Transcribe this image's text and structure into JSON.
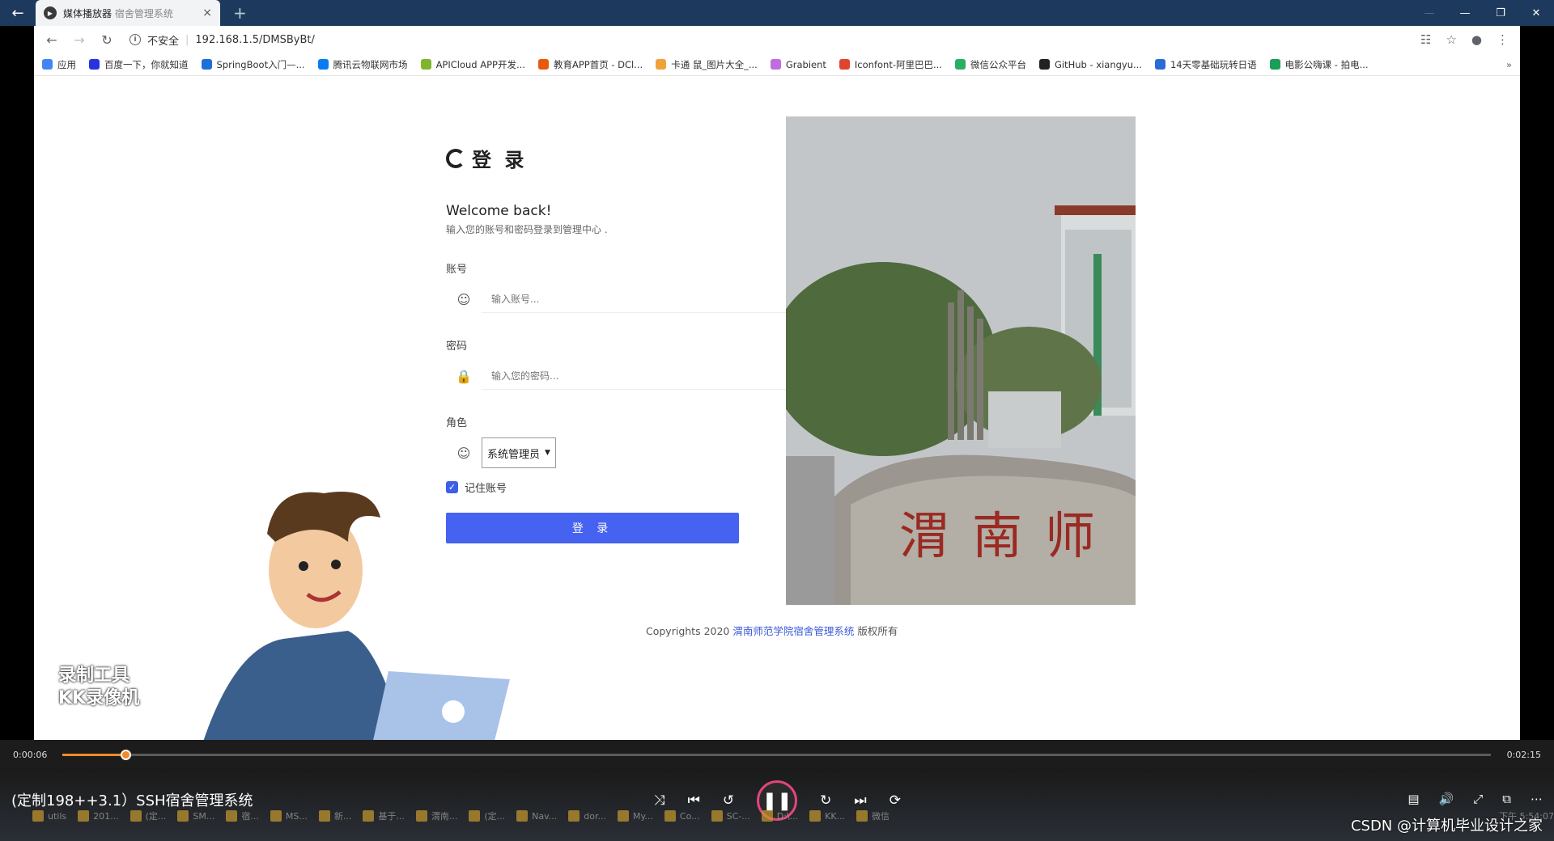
{
  "player_tab": {
    "app": "媒体播放器",
    "page_title": "宿舍管理系统"
  },
  "browser": {
    "security_label": "不安全",
    "url": "192.168.1.5/DMSByBt/",
    "bookmarks": [
      {
        "label": "应用",
        "icon_color": "#4285f4"
      },
      {
        "label": "百度一下，你就知道",
        "icon_color": "#2932e1"
      },
      {
        "label": "SpringBoot入门—...",
        "icon_color": "#1e6fd9"
      },
      {
        "label": "腾讯云物联网市场",
        "icon_color": "#0a7cf2"
      },
      {
        "label": "APICloud APP开发...",
        "icon_color": "#7fb52e"
      },
      {
        "label": "教育APP首页 - DCl...",
        "icon_color": "#e8590c"
      },
      {
        "label": "卡通 鼠_图片大全_...",
        "icon_color": "#f0a23a"
      },
      {
        "label": "Grabient",
        "icon_color": "#c06be0"
      },
      {
        "label": "Iconfont-阿里巴巴...",
        "icon_color": "#e0442f"
      },
      {
        "label": "微信公众平台",
        "icon_color": "#2aae67"
      },
      {
        "label": "GitHub - xiangyu...",
        "icon_color": "#222222"
      },
      {
        "label": "14天零基础玩转日语",
        "icon_color": "#2a6bd8"
      },
      {
        "label": "电影公嗨课 - 拍电...",
        "icon_color": "#1a9e5a"
      }
    ]
  },
  "login": {
    "brand": "登 录",
    "welcome": "Welcome back!",
    "subtitle": "输入您的账号和密码登录到管理中心 .",
    "account_label": "账号",
    "account_placeholder": "输入账号...",
    "password_label": "密码",
    "password_placeholder": "输入您的密码...",
    "role_label": "角色",
    "role_value": "系统管理员",
    "remember_label": "记住账号",
    "remember_checked": true,
    "submit": "登 录",
    "copyright_prefix": "Copyrights 2020",
    "copyright_link": "渭南师范学院宿舍管理系统",
    "copyright_suffix": "版权所有",
    "photo_caption": "渭南师"
  },
  "watermark": {
    "line1": "录制工具",
    "line2": "KK录像机"
  },
  "player": {
    "current_time": "0:00:06",
    "total_time": "0:02:15",
    "progress": 0.0444,
    "video_title": "(定制198++3.1）SSH宿舍管理系统",
    "accent_color": "#f08a2a",
    "play_state": "playing"
  },
  "taskbar": {
    "items": [
      "utils",
      "201...",
      "(定...",
      "SM...",
      "宿...",
      "MS...",
      "新...",
      "基于...",
      "渭南...",
      "(定...",
      "Nav...",
      "dor...",
      "My...",
      "Co...",
      "SC-...",
      "D:\\...",
      "KK...",
      "微信"
    ],
    "clock": "下午 5:54:07"
  },
  "csdn_watermark": "CSDN @计算机毕业设计之家"
}
